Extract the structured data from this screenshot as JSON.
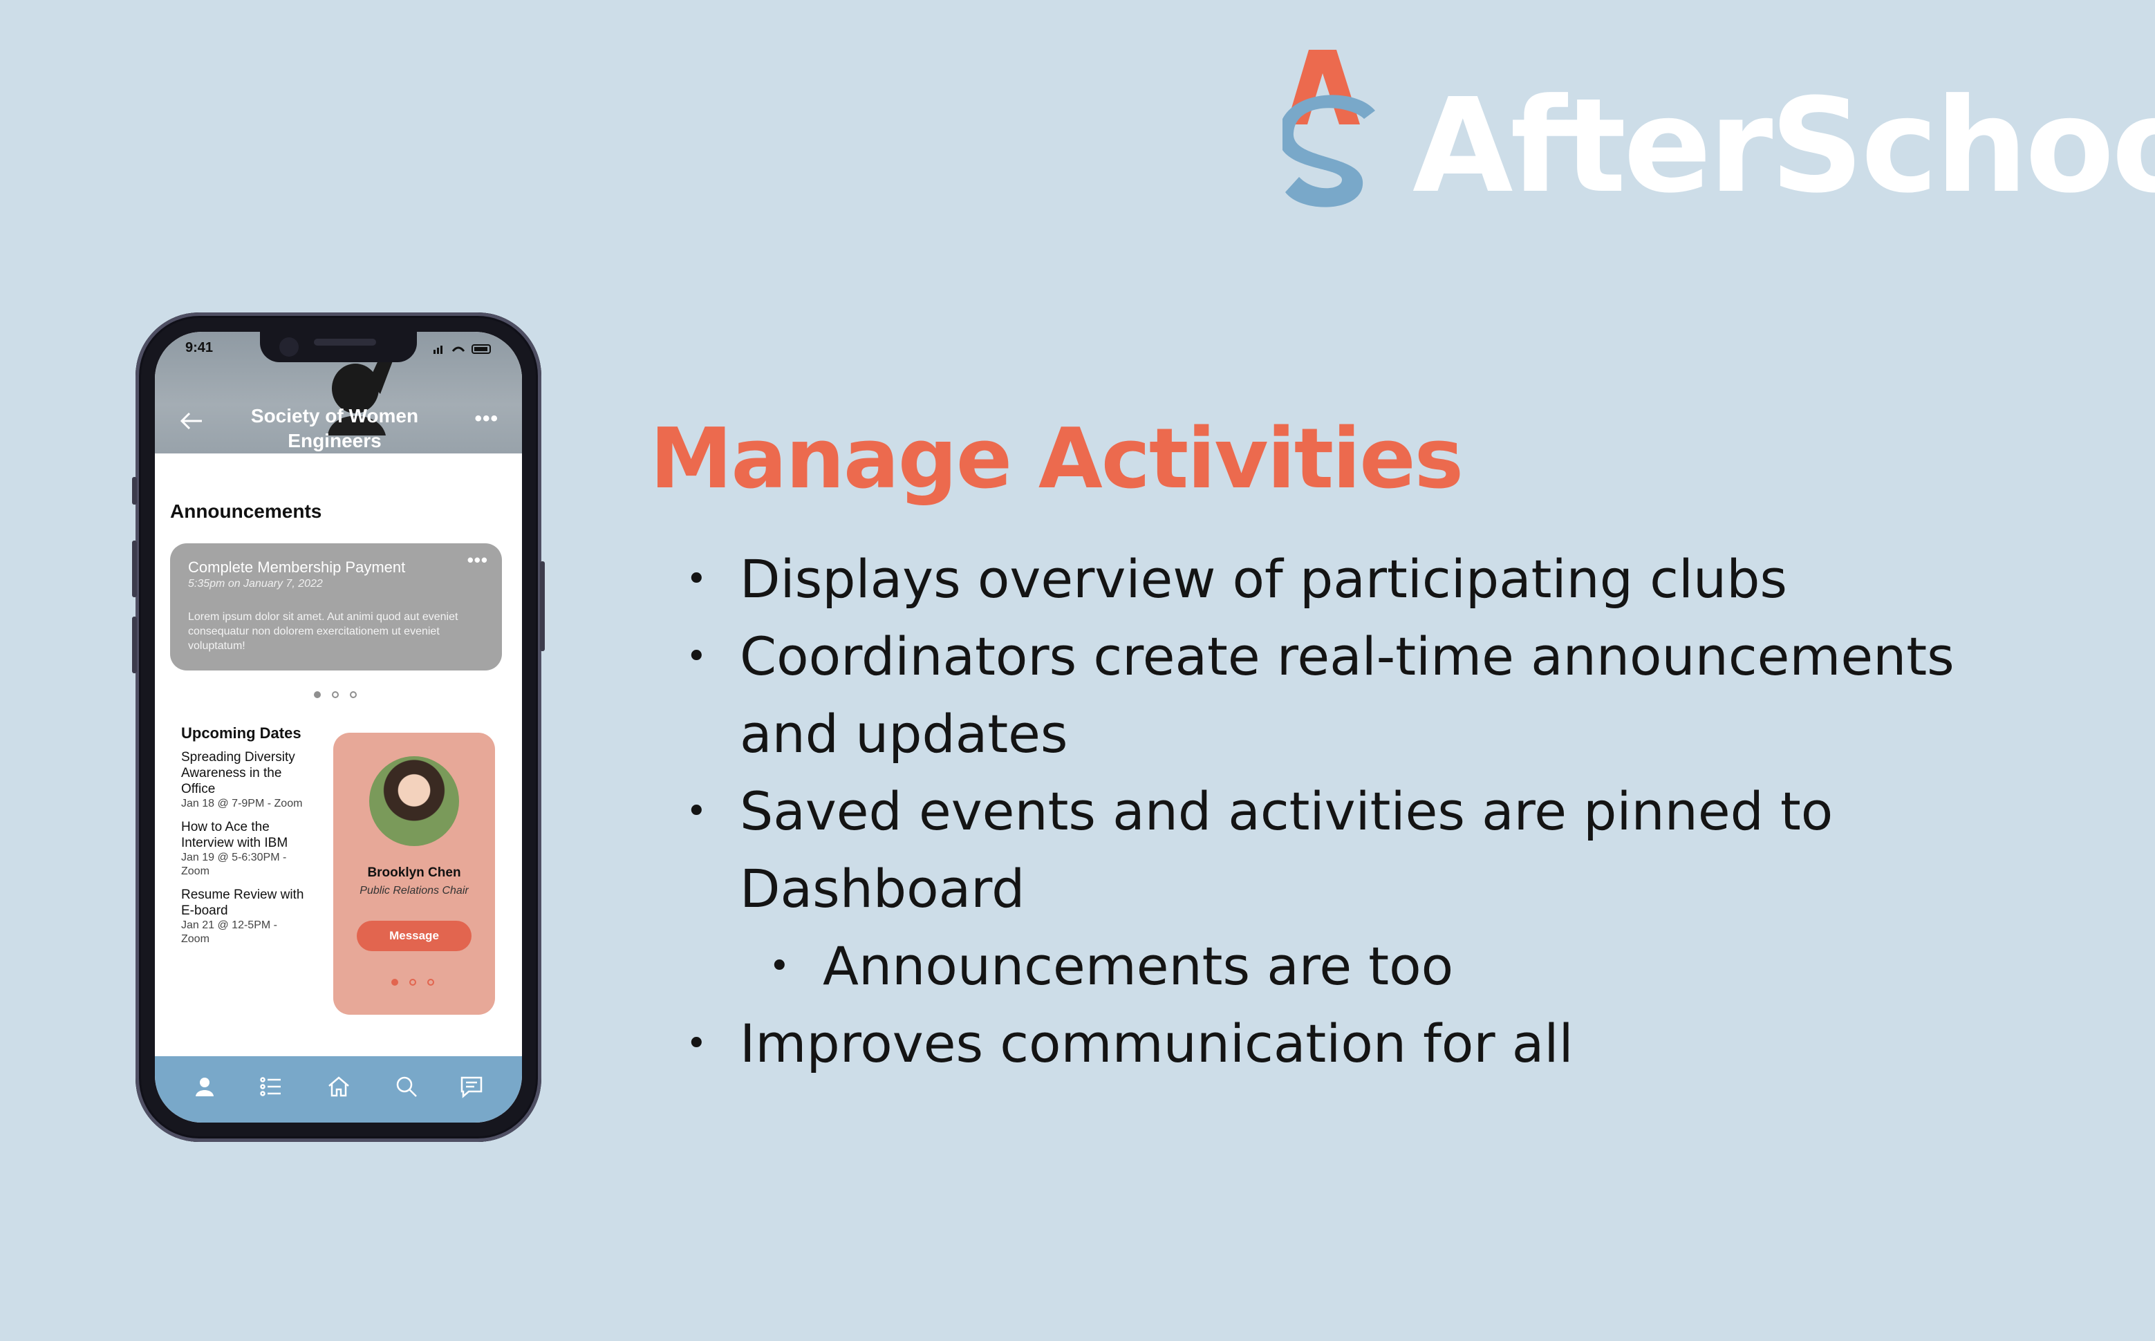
{
  "brand": {
    "name": "AfterSchool",
    "colors": {
      "accent": "#ec6a4e",
      "secondary": "#79a8c9",
      "background": "#cddde8"
    }
  },
  "slide": {
    "title": "Manage Activities",
    "bullets": [
      "Displays overview of participating clubs",
      "Coordinators create real-time announcements and updates",
      "Saved events and activities are pinned to Dashboard",
      "Announcements are too",
      "Improves communication for all"
    ]
  },
  "phone": {
    "status": {
      "time": "9:41"
    },
    "header": {
      "title": "Society of Women Engineers",
      "back_icon": "arrow-left-icon",
      "more_icon": "more-dots-icon"
    },
    "announcements": {
      "heading": "Announcements",
      "card": {
        "title": "Complete Membership Payment",
        "time": "5:35pm on January 7, 2022",
        "body": "Lorem ipsum dolor sit amet. Aut animi quod aut eveniet consequatur non dolorem exercitationem ut eveniet voluptatum!"
      }
    },
    "upcoming": {
      "heading": "Upcoming Dates",
      "items": [
        {
          "title": "Spreading Diversity Awareness in the Office",
          "meta": "Jan 18 @ 7-9PM - Zoom"
        },
        {
          "title": "How to Ace the Interview with IBM",
          "meta": "Jan 19 @ 5-6:30PM - Zoom"
        },
        {
          "title": "Resume Review with E-board",
          "meta": "Jan 21 @ 12-5PM - Zoom"
        }
      ]
    },
    "contact": {
      "name": "Brooklyn Chen",
      "role": "Public Relations Chair",
      "button": "Message"
    },
    "tabbar": [
      "profile-icon",
      "list-icon",
      "home-icon",
      "search-icon",
      "chat-icon"
    ]
  }
}
